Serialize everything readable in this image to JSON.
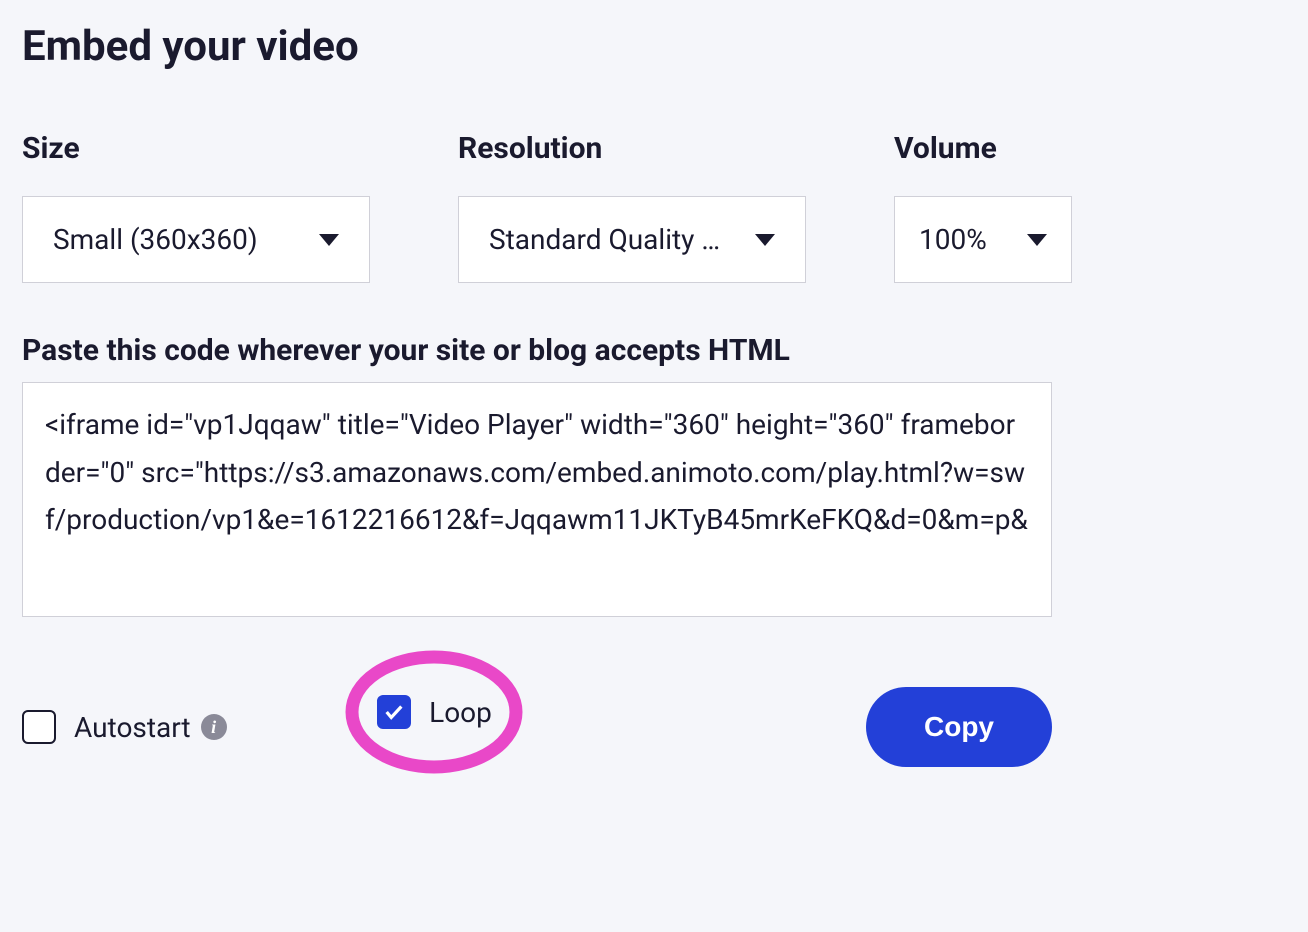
{
  "title": "Embed your video",
  "size": {
    "label": "Size",
    "value": "Small (360x360)"
  },
  "resolution": {
    "label": "Resolution",
    "value": "Standard Quality (..."
  },
  "volume": {
    "label": "Volume",
    "value": "100%"
  },
  "codeLabel": "Paste this code wherever your site or blog accepts HTML",
  "codeContent": "<iframe id=\"vp1Jqqaw\" title=\"Video Player\" width=\"360\" height=\"360\" frameborder=\"0\" src=\"https://s3.amazonaws.com/embed.animoto.com/play.html?w=swf/production/vp1&e=1612216612&f=Jqqawm11JKTyB45mrKeFKQ&d=0&m=p&",
  "autostart": {
    "label": "Autostart",
    "checked": false
  },
  "loop": {
    "label": "Loop",
    "checked": true
  },
  "copyButton": "Copy",
  "colors": {
    "primary": "#2340d8",
    "annotation": "#e948c8"
  }
}
